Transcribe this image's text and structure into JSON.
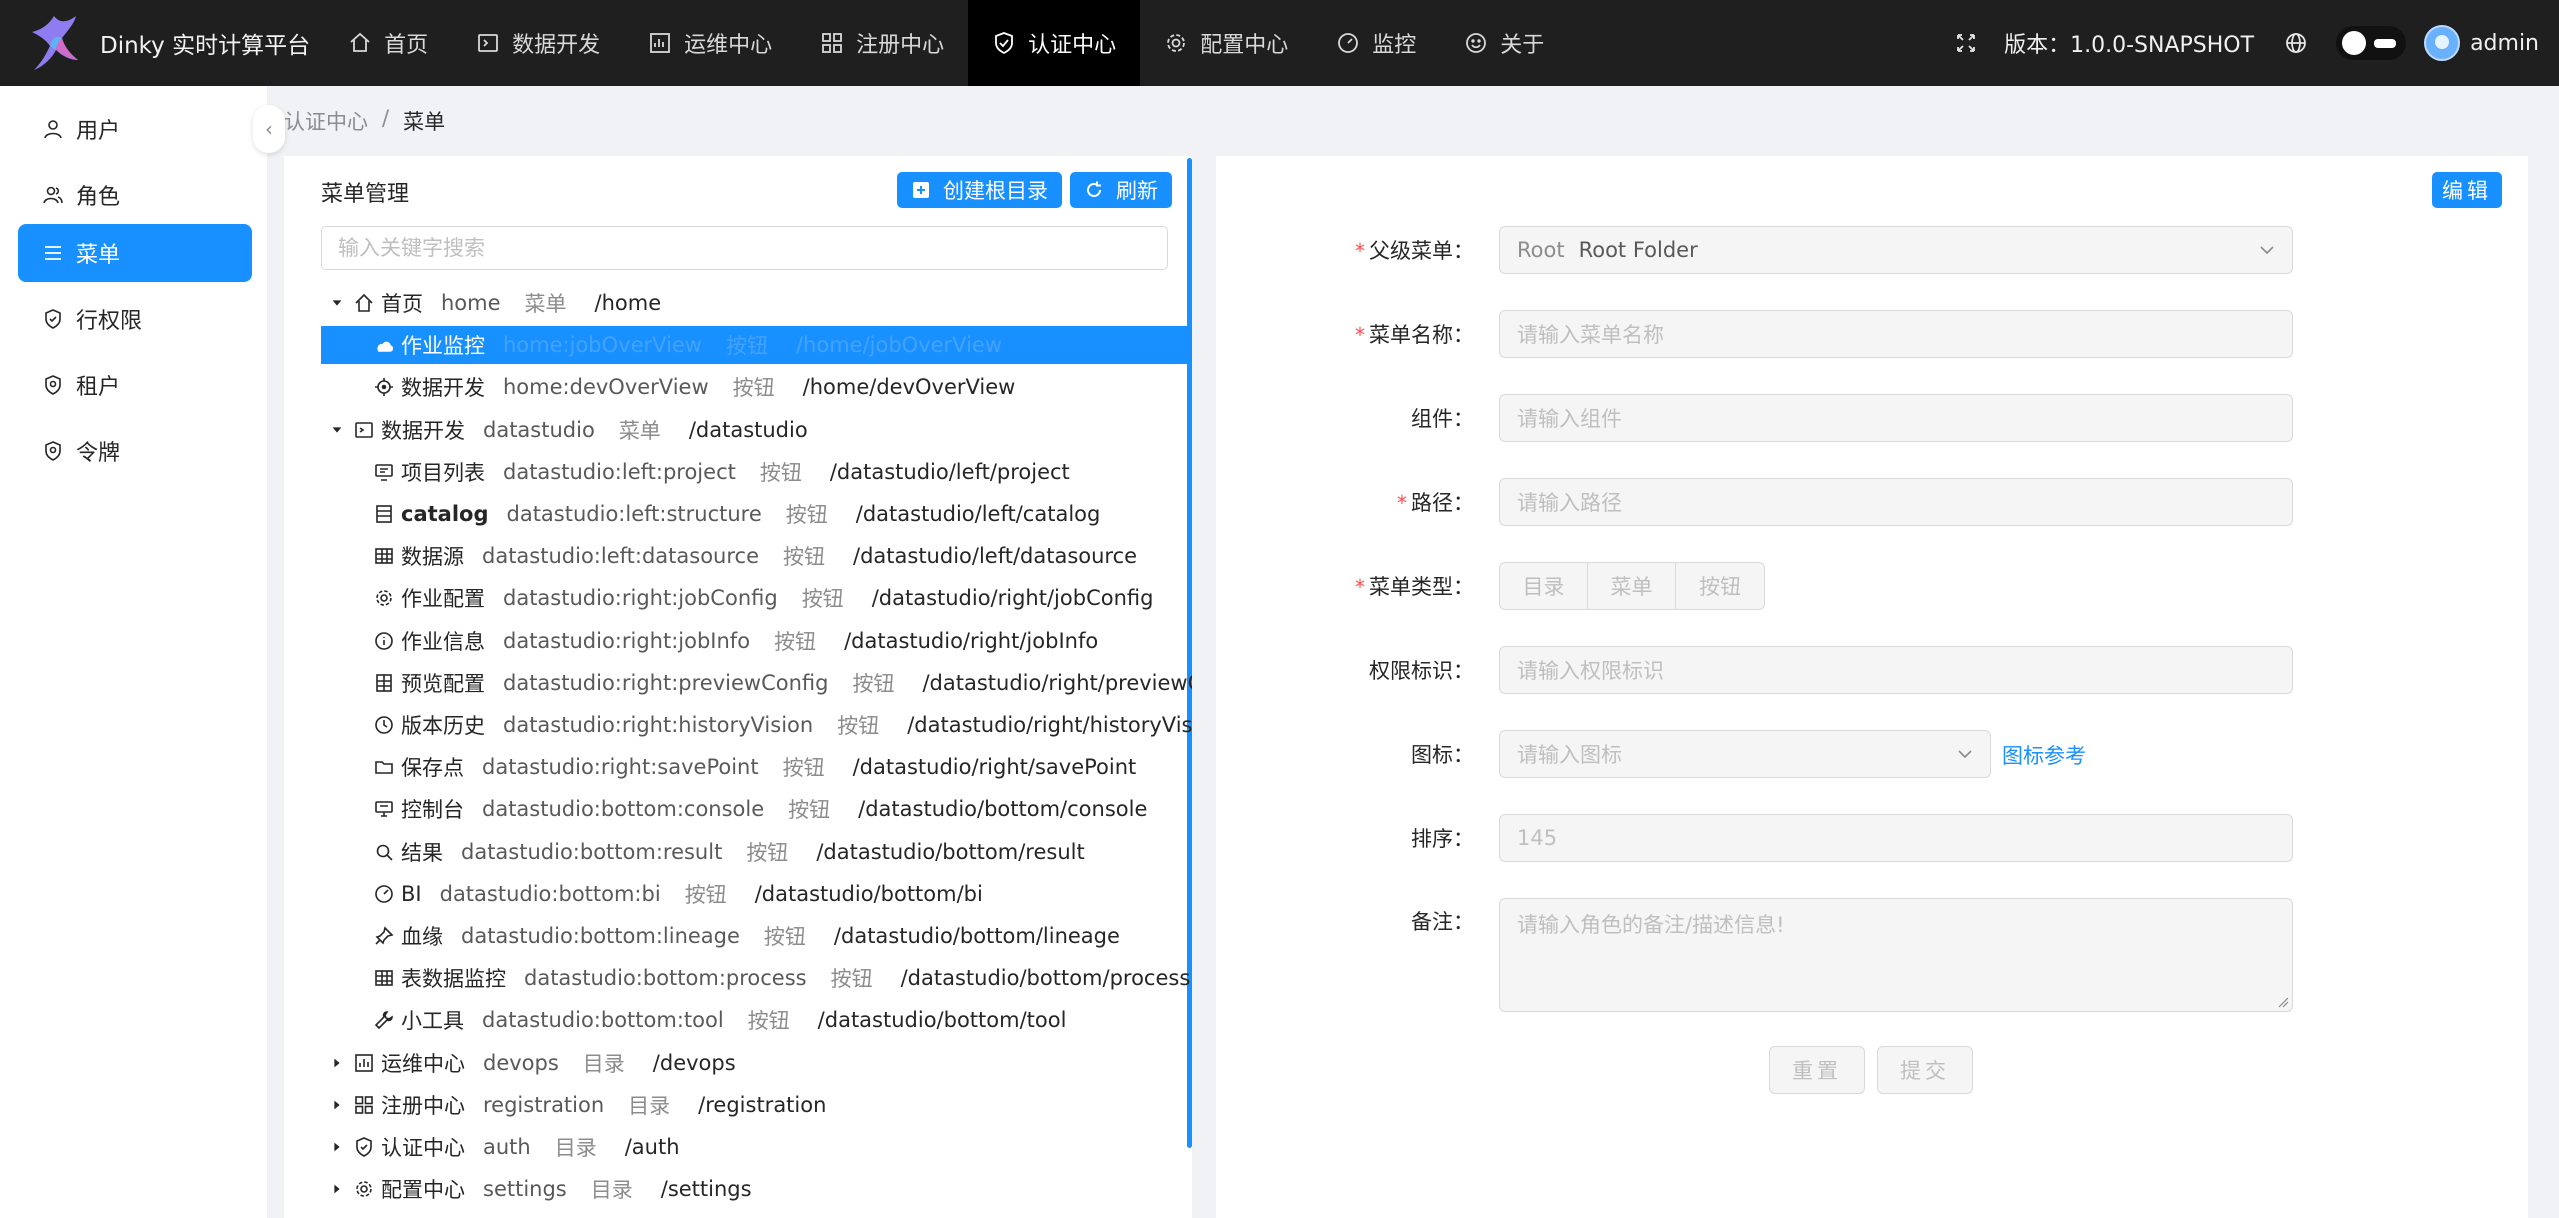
{
  "header": {
    "app_title": "Dinky 实时计算平台",
    "nav": [
      {
        "label": "首页",
        "icon": "home-icon"
      },
      {
        "label": "数据开发",
        "icon": "console-icon"
      },
      {
        "label": "运维中心",
        "icon": "fund-icon"
      },
      {
        "label": "注册中心",
        "icon": "appstore-icon"
      },
      {
        "label": "认证中心",
        "icon": "shield-icon"
      },
      {
        "label": "配置中心",
        "icon": "setting-icon"
      },
      {
        "label": "监控",
        "icon": "dashboard-icon"
      },
      {
        "label": "关于",
        "icon": "smile-icon"
      }
    ],
    "active_nav": "认证中心",
    "version": "版本：1.0.0-SNAPSHOT",
    "user_name": "admin"
  },
  "sidebar": {
    "items": [
      {
        "label": "用户",
        "icon": "user-icon"
      },
      {
        "label": "角色",
        "icon": "team-icon"
      },
      {
        "label": "菜单",
        "icon": "menu-icon"
      },
      {
        "label": "行权限",
        "icon": "security-icon"
      },
      {
        "label": "租户",
        "icon": "security-icon"
      },
      {
        "label": "令牌",
        "icon": "security-icon"
      }
    ],
    "active": "菜单"
  },
  "breadcrumb": {
    "parent": "认证中心",
    "separator": "/",
    "current": "菜单"
  },
  "tree_panel": {
    "title": "菜单管理",
    "create_root_label": "创建根目录",
    "refresh_label": "刷新",
    "search_placeholder": "输入关键字搜索",
    "rows": [
      {
        "name": "首页",
        "key": "home",
        "type": "菜单",
        "path": "/home",
        "icon": "home-icon",
        "level": 0,
        "expand": "open"
      },
      {
        "name": "作业监控",
        "key": "home:jobOverView",
        "type": "按钮",
        "path": "/home/jobOverView",
        "icon": "cloud-icon",
        "level": 1,
        "expand": "none",
        "selected": true
      },
      {
        "name": "数据开发",
        "key": "home:devOverView",
        "type": "按钮",
        "path": "/home/devOverView",
        "icon": "aim-icon",
        "level": 1,
        "expand": "none"
      },
      {
        "name": "数据开发",
        "key": "datastudio",
        "type": "菜单",
        "path": "/datastudio",
        "icon": "console-icon",
        "level": 0,
        "expand": "open"
      },
      {
        "name": "项目列表",
        "key": "datastudio:left:project",
        "type": "按钮",
        "path": "/datastudio/left/project",
        "icon": "project-icon",
        "level": 1,
        "expand": "none"
      },
      {
        "name": "catalog",
        "key": "datastudio:left:structure",
        "type": "按钮",
        "path": "/datastudio/left/catalog",
        "icon": "table-icon",
        "level": 1,
        "expand": "none",
        "bold": true
      },
      {
        "name": "数据源",
        "key": "datastudio:left:datasource",
        "type": "按钮",
        "path": "/datastudio/left/datasource",
        "icon": "grid-icon",
        "level": 1,
        "expand": "none"
      },
      {
        "name": "作业配置",
        "key": "datastudio:right:jobConfig",
        "type": "按钮",
        "path": "/datastudio/right/jobConfig",
        "icon": "setting-icon",
        "level": 1,
        "expand": "none"
      },
      {
        "name": "作业信息",
        "key": "datastudio:right:jobInfo",
        "type": "按钮",
        "path": "/datastudio/right/jobInfo",
        "icon": "info-icon",
        "level": 1,
        "expand": "none"
      },
      {
        "name": "预览配置",
        "key": "datastudio:right:previewConfig",
        "type": "按钮",
        "path": "/datastudio/right/previewConfig",
        "icon": "insert-row-icon",
        "level": 1,
        "expand": "none"
      },
      {
        "name": "版本历史",
        "key": "datastudio:right:historyVision",
        "type": "按钮",
        "path": "/datastudio/right/historyVision",
        "icon": "history-icon",
        "level": 1,
        "expand": "none"
      },
      {
        "name": "保存点",
        "key": "datastudio:right:savePoint",
        "type": "按钮",
        "path": "/datastudio/right/savePoint",
        "icon": "folder-icon",
        "level": 1,
        "expand": "none"
      },
      {
        "name": "控制台",
        "key": "datastudio:bottom:console",
        "type": "按钮",
        "path": "/datastudio/bottom/console",
        "icon": "desktop-icon",
        "level": 1,
        "expand": "none"
      },
      {
        "name": "结果",
        "key": "datastudio:bottom:result",
        "type": "按钮",
        "path": "/datastudio/bottom/result",
        "icon": "search-icon",
        "level": 1,
        "expand": "none"
      },
      {
        "name": "BI",
        "key": "datastudio:bottom:bi",
        "type": "按钮",
        "path": "/datastudio/bottom/bi",
        "icon": "dashboard-icon",
        "level": 1,
        "expand": "none"
      },
      {
        "name": "血缘",
        "key": "datastudio:bottom:lineage",
        "type": "按钮",
        "path": "/datastudio/bottom/lineage",
        "icon": "pushpin-icon",
        "level": 1,
        "expand": "none"
      },
      {
        "name": "表数据监控",
        "key": "datastudio:bottom:process",
        "type": "按钮",
        "path": "/datastudio/bottom/process",
        "icon": "grid-icon",
        "level": 1,
        "expand": "none"
      },
      {
        "name": "小工具",
        "key": "datastudio:bottom:tool",
        "type": "按钮",
        "path": "/datastudio/bottom/tool",
        "icon": "tool-icon",
        "level": 1,
        "expand": "none"
      },
      {
        "name": "运维中心",
        "key": "devops",
        "type": "目录",
        "path": "/devops",
        "icon": "fund-icon",
        "level": 0,
        "expand": "closed"
      },
      {
        "name": "注册中心",
        "key": "registration",
        "type": "目录",
        "path": "/registration",
        "icon": "appstore-icon",
        "level": 0,
        "expand": "closed"
      },
      {
        "name": "认证中心",
        "key": "auth",
        "type": "目录",
        "path": "/auth",
        "icon": "shield-icon",
        "level": 0,
        "expand": "closed"
      },
      {
        "name": "配置中心",
        "key": "settings",
        "type": "目录",
        "path": "/settings",
        "icon": "setting-icon",
        "level": 0,
        "expand": "closed"
      }
    ]
  },
  "form": {
    "edit_label": "编辑",
    "parent_menu_label": "父级菜单：",
    "parent_menu_value_tag": "Root",
    "parent_menu_value": "Root Folder",
    "name_label": "菜单名称：",
    "name_placeholder": "请输入菜单名称",
    "component_label": "组件：",
    "component_placeholder": "请输入组件",
    "path_label": "路径：",
    "path_placeholder": "请输入路径",
    "type_label": "菜单类型：",
    "type_options": [
      "目录",
      "菜单",
      "按钮"
    ],
    "perms_label": "权限标识：",
    "perms_placeholder": "请输入权限标识",
    "icon_label": "图标：",
    "icon_placeholder": "请输入图标",
    "icon_ref_link": "图标参考",
    "order_label": "排序：",
    "order_value": "145",
    "note_label": "备注：",
    "note_placeholder": "请输入角色的备注/描述信息!",
    "reset_label": "重置",
    "submit_label": "提交"
  },
  "colors": {
    "primary": "#1890ff",
    "header_bg": "#1f1f1f",
    "required": "#ff4d4f"
  }
}
